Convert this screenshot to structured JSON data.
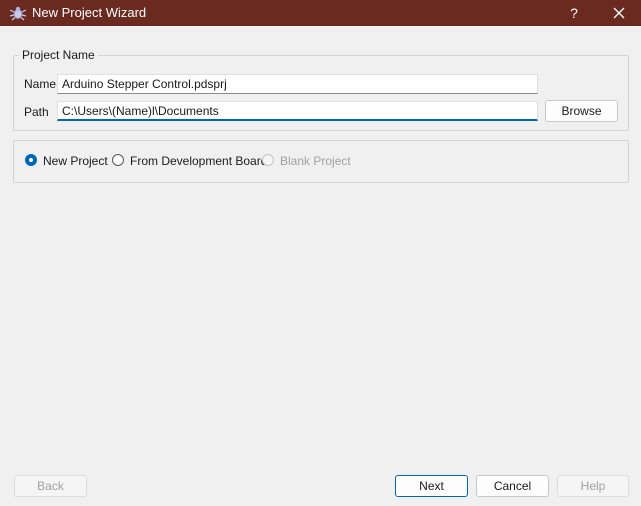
{
  "window": {
    "title": "New Project Wizard",
    "help_label": "?",
    "icon": "bug-icon",
    "titlebar_color": "#6b2a20"
  },
  "project_group": {
    "legend": "Project Name",
    "name_label": "Name",
    "name_value": "Arduino Stepper Control.pdsprj",
    "path_label": "Path",
    "path_value": "C:\\Users\\(Name)l\\Documents",
    "browse_label": "Browse"
  },
  "project_type": {
    "options": [
      {
        "label": "New Project",
        "checked": true,
        "disabled": false
      },
      {
        "label": "From Development Board",
        "checked": false,
        "disabled": false
      },
      {
        "label": "Blank Project",
        "checked": false,
        "disabled": true
      }
    ]
  },
  "footer": {
    "back_label": "Back",
    "next_label": "Next",
    "cancel_label": "Cancel",
    "help_label": "Help"
  },
  "colors": {
    "accent": "#0067c0",
    "background": "#f0f0f0"
  }
}
